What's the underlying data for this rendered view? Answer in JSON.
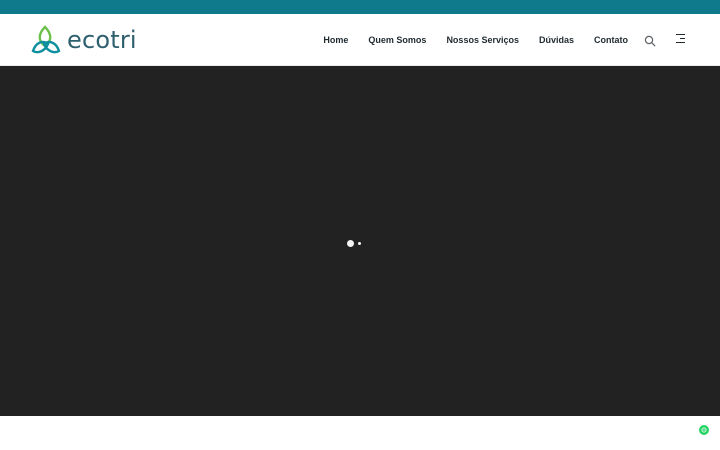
{
  "brand": {
    "name": "ecotri",
    "colors": {
      "topbar": "#0e7a8c",
      "logo_green": "#6cc04a",
      "logo_teal": "#0e8fa0",
      "logo_text": "#2e5f6e"
    }
  },
  "nav": {
    "items": [
      {
        "label": "Home"
      },
      {
        "label": "Quem Somos"
      },
      {
        "label": "Nossos Serviços"
      },
      {
        "label": "Dúvidas"
      },
      {
        "label": "Contato"
      }
    ]
  },
  "icons": {
    "search": "search-icon",
    "menu": "hamburger-menu-icon",
    "whatsapp": "whatsapp-icon",
    "logo": "trefoil-logo-icon"
  },
  "hero": {
    "background": "#222222",
    "state": "loading"
  }
}
